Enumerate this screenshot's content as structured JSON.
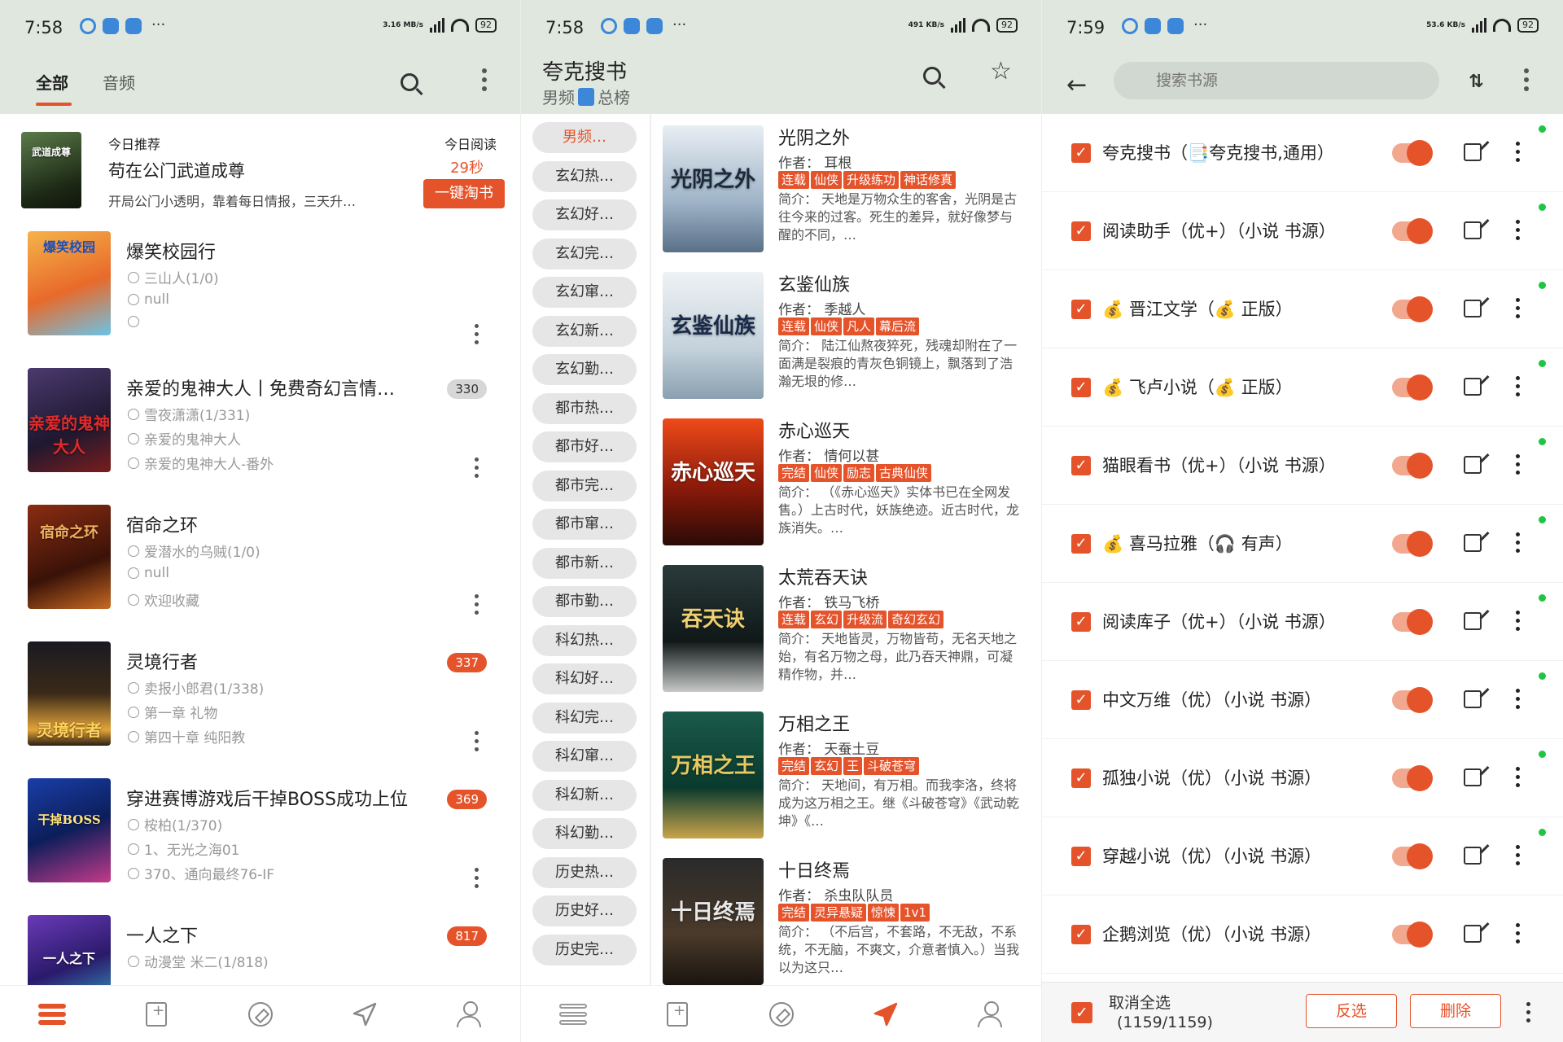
{
  "panel1": {
    "status": {
      "time": "7:58",
      "net": "3.16 MB/s",
      "battery": "92"
    },
    "tabs": [
      "全部",
      "音频"
    ],
    "featured": {
      "label": "今日推荐",
      "title": "苟在公门武道成尊",
      "desc": "开局公门小透明，靠着每日情报，三天升…",
      "read_label": "今日阅读",
      "read_time": "29秒",
      "button": "一键淘书",
      "cover_text": "武道成尊"
    },
    "books": [
      {
        "title": "爆笑校园行",
        "author": "三山人(1/0)",
        "latest": "null",
        "read": "",
        "badge": "",
        "cover_text": "爆笑校园"
      },
      {
        "title": "亲爱的鬼神大人丨免费奇幻言情…",
        "author": "雪夜潇潇(1/331)",
        "latest": "亲爱的鬼神大人",
        "read": "亲爱的鬼神大人-番外",
        "badge": "330",
        "cover_text": "亲爱的鬼神大人"
      },
      {
        "title": "宿命之环",
        "author": "爱潜水的乌贼(1/0)",
        "latest": "null",
        "read": "欢迎收藏",
        "badge": "",
        "cover_text": "宿命之环"
      },
      {
        "title": "灵境行者",
        "author": "卖报小郎君(1/338)",
        "latest": "第一章 礼物",
        "read": "第四十章 纯阳教",
        "badge": "337",
        "cover_text": "灵境行者"
      },
      {
        "title": "穿进赛博游戏后干掉BOSS成功上位",
        "author": "桉柏(1/370)",
        "latest": "1、无光之海01",
        "read": "370、通向最终76-IF",
        "badge": "369",
        "cover_text": "干掉BOSS"
      },
      {
        "title": "一人之下",
        "author": "动漫堂 米二(1/818)",
        "latest": "",
        "read": "",
        "badge": "817",
        "cover_text": "一人之下"
      }
    ]
  },
  "panel2": {
    "status": {
      "time": "7:58",
      "net": "491 KB/s",
      "battery": "92"
    },
    "title": "夸克搜书",
    "sub_left": "男频",
    "sub_right": "总榜",
    "categories": [
      "男频…",
      "玄幻热…",
      "玄幻好…",
      "玄幻完…",
      "玄幻窜…",
      "玄幻新…",
      "玄幻勤…",
      "都市热…",
      "都市好…",
      "都市完…",
      "都市窜…",
      "都市新…",
      "都市勤…",
      "科幻热…",
      "科幻好…",
      "科幻完…",
      "科幻窜…",
      "科幻新…",
      "科幻勤…",
      "历史热…",
      "历史好…",
      "历史完…"
    ],
    "books": [
      {
        "title": "光阴之外",
        "author": "作者：  耳根",
        "tags": [
          "连载",
          "仙侠",
          "升级练功",
          "神话修真"
        ],
        "desc": "简介：  天地是万物众生的客舍，光阴是古往今来的过客。死生的差异，就好像梦与醒的不同，…",
        "cover_text": "光阴之外"
      },
      {
        "title": "玄鉴仙族",
        "author": "作者：  季越人",
        "tags": [
          "连载",
          "仙侠",
          "凡人",
          "幕后流"
        ],
        "desc": "简介：  陆江仙熬夜猝死，残魂却附在了一面满是裂痕的青灰色铜镜上，飘落到了浩瀚无垠的修…",
        "cover_text": "玄鉴仙族"
      },
      {
        "title": "赤心巡天",
        "author": "作者：  情何以甚",
        "tags": [
          "完结",
          "仙侠",
          "励志",
          "古典仙侠"
        ],
        "desc": "简介：  （《赤心巡天》实体书已在全网发售。）上古时代，妖族绝迹。近古时代，龙族消失。…",
        "cover_text": "赤心巡天"
      },
      {
        "title": "太荒吞天诀",
        "author": "作者：  铁马飞桥",
        "tags": [
          "连载",
          "玄幻",
          "升级流",
          "奇幻玄幻"
        ],
        "desc": "简介：  天地皆灵，万物皆苟，无名天地之始，有名万物之母，此乃吞天神鼎，可凝精作物，并…",
        "cover_text": "吞天诀"
      },
      {
        "title": "万相之王",
        "author": "作者：  天蚕土豆",
        "tags": [
          "完结",
          "玄幻",
          "王",
          "斗破苍穹"
        ],
        "desc": "简介：  天地间，有万相。而我李洛，终将成为这万相之王。继《斗破苍穹》《武动乾坤》《…",
        "cover_text": "万相之王"
      },
      {
        "title": "十日终焉",
        "author": "作者：  杀虫队队员",
        "tags": [
          "完结",
          "灵异悬疑",
          "惊悚",
          "1v1"
        ],
        "desc": "简介：  （不后宫，不套路，不无敌，不系统，不无脑，不爽文，介意者慎入。）当我以为这只…",
        "cover_text": "十日终焉"
      }
    ]
  },
  "panel3": {
    "status": {
      "time": "7:59",
      "net": "53.6 KB/s",
      "battery": "92"
    },
    "search_placeholder": "搜索书源",
    "sources": [
      "夸克搜书（📑夸克搜书,通用）",
      "阅读助手（优+）（小说 书源）",
      "💰 晋江文学（💰 正版）",
      "💰 飞卢小说（💰 正版）",
      "猫眼看书（优+）（小说 书源）",
      "💰 喜马拉雅（🎧 有声）",
      "阅读库子（优+）（小说 书源）",
      "中文万维（优）（小说 书源）",
      "孤独小说（优）（小说 书源）",
      "穿越小说（优）（小说 书源）",
      "企鹅浏览（优）（小说 书源）"
    ],
    "select_all": "取消全选",
    "count": "(1159/1159)",
    "invert_btn": "反选",
    "delete_btn": "删除"
  },
  "colors": {
    "accent": "#e5532b",
    "header_bg": "#dfe7df",
    "online_dot": "#1ec545"
  }
}
